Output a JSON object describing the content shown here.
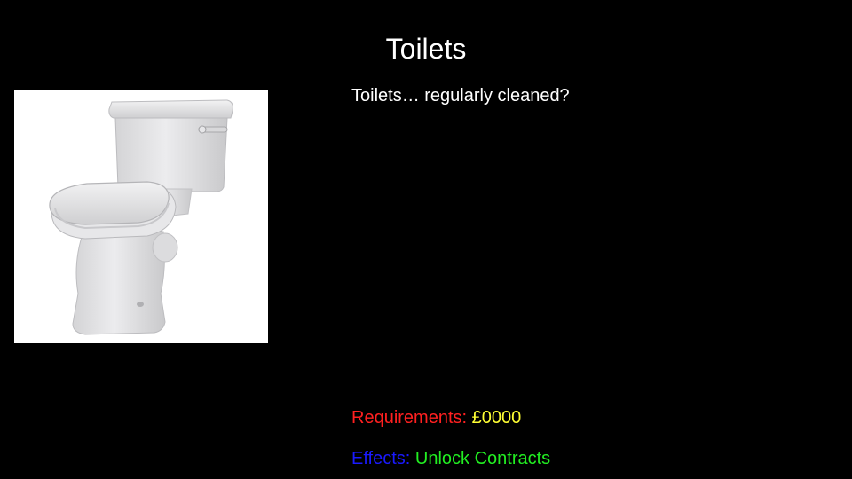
{
  "slide": {
    "title": "Toilets",
    "description": "Toilets… regularly cleaned?",
    "requirements": {
      "label": "Requirements: ",
      "value": "£0000",
      "label_color": "#ff2020",
      "value_color": "#ffff33"
    },
    "effects": {
      "label": "Effects: ",
      "value": "Unlock Contracts",
      "label_color": "#1a1aff",
      "value_color": "#22ee22"
    },
    "image": {
      "icon": "toilet-icon",
      "background": "#ffffff"
    }
  }
}
